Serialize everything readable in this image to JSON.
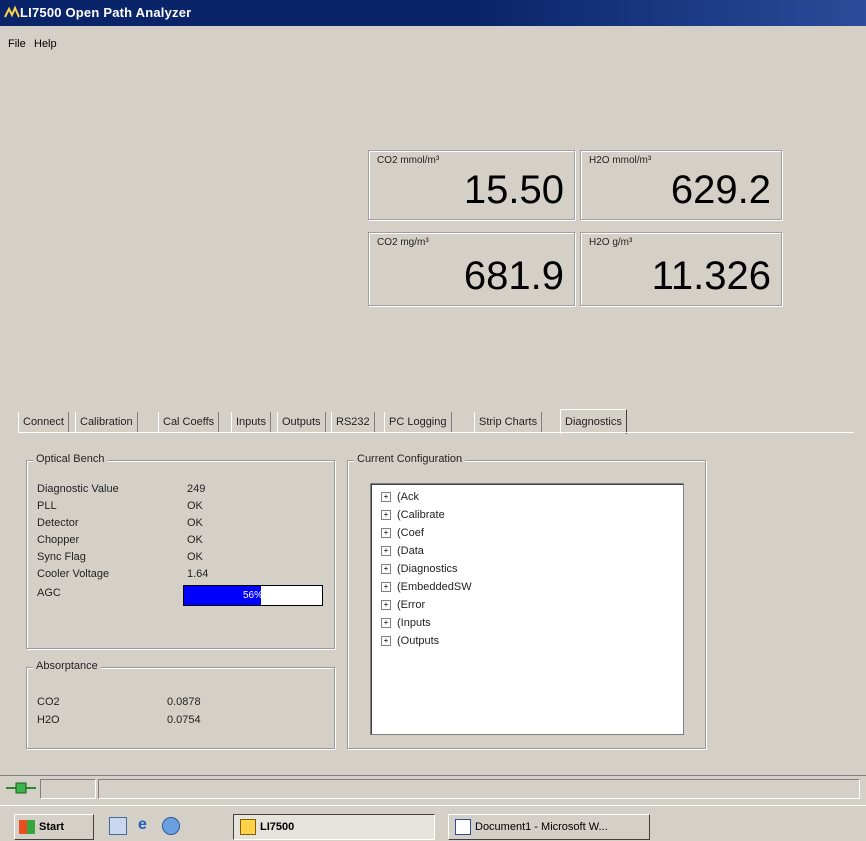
{
  "window": {
    "title": "LI7500 Open Path Analyzer"
  },
  "menu": {
    "items": [
      "File",
      "Help"
    ]
  },
  "readouts": {
    "co2_mmol": {
      "label": "CO2 mmol/m³",
      "value": "15.50"
    },
    "h2o_mmol": {
      "label": "H2O mmol/m³",
      "value": "629.2"
    },
    "co2_mg": {
      "label": "CO2 mg/m³",
      "value": "681.9"
    },
    "h2o_g": {
      "label": "H2O g/m³",
      "value": "11.326"
    }
  },
  "tabs": [
    "Connect",
    "Calibration",
    "Cal Coeffs",
    "Inputs",
    "Outputs",
    "RS232",
    "PC Logging",
    "Strip Charts",
    "Diagnostics"
  ],
  "active_tab": "Diagnostics",
  "optical_bench": {
    "title": "Optical Bench",
    "rows": [
      {
        "label": "Diagnostic Value",
        "value": "249"
      },
      {
        "label": "PLL",
        "value": "OK"
      },
      {
        "label": "Detector",
        "value": "OK"
      },
      {
        "label": "Chopper",
        "value": "OK"
      },
      {
        "label": "Sync Flag",
        "value": "OK"
      },
      {
        "label": "Cooler Voltage",
        "value": "1.64"
      }
    ],
    "agc": {
      "label": "AGC",
      "value_text": "56%",
      "fraction": 0.56
    }
  },
  "absorptance": {
    "title": "Absorptance",
    "rows": [
      {
        "label": "CO2",
        "value": "0.0878"
      },
      {
        "label": "H2O",
        "value": "0.0754"
      }
    ]
  },
  "configuration": {
    "title": "Current Configuration",
    "items": [
      "(Ack",
      "(Calibrate",
      "(Coef",
      "(Data",
      "(Diagnostics",
      "(EmbeddedSW",
      "(Error",
      "(Inputs",
      "(Outputs"
    ]
  },
  "taskbar": {
    "start": "Start",
    "buttons": [
      "LI7500",
      "Document1 - Microsoft W..."
    ]
  },
  "colors": {
    "titlebar": "#0a246a",
    "agc_fill": "#0000ff",
    "face": "#d4d0c8"
  }
}
